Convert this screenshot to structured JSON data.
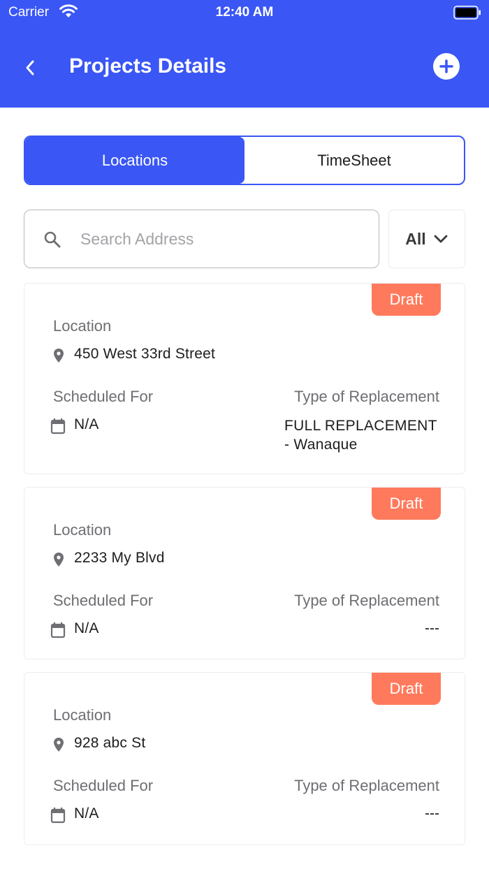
{
  "status_bar": {
    "carrier": "Carrier",
    "time": "12:40 AM"
  },
  "header": {
    "title": "Projects Details"
  },
  "tabs": [
    {
      "label": "Locations",
      "active": true
    },
    {
      "label": "TimeSheet",
      "active": false
    }
  ],
  "search": {
    "placeholder": "Search Address",
    "value": ""
  },
  "filter": {
    "label": "All"
  },
  "cards": [
    {
      "badge": "Draft",
      "location_label": "Location",
      "address": "450 West 33rd Street",
      "scheduled_label": "Scheduled For",
      "scheduled_value": "N/A",
      "replacement_label": "Type of Replacement",
      "replacement_line1": "FULL REPLACEMENT",
      "replacement_line2": "- Wanaque"
    },
    {
      "badge": "Draft",
      "location_label": "Location",
      "address": "2233 My Blvd",
      "scheduled_label": "Scheduled For",
      "scheduled_value": "N/A",
      "replacement_label": "Type of Replacement",
      "replacement_value": "---"
    },
    {
      "badge": "Draft",
      "location_label": "Location",
      "address": "928 abc St",
      "scheduled_label": "Scheduled For",
      "scheduled_value": "N/A",
      "replacement_label": "Type of Replacement",
      "replacement_value": "---"
    }
  ],
  "colors": {
    "primary": "#3a56f5",
    "badge": "#ff7a5c",
    "muted_text": "#6e6e73",
    "icon_gray": "#6e6e73"
  }
}
